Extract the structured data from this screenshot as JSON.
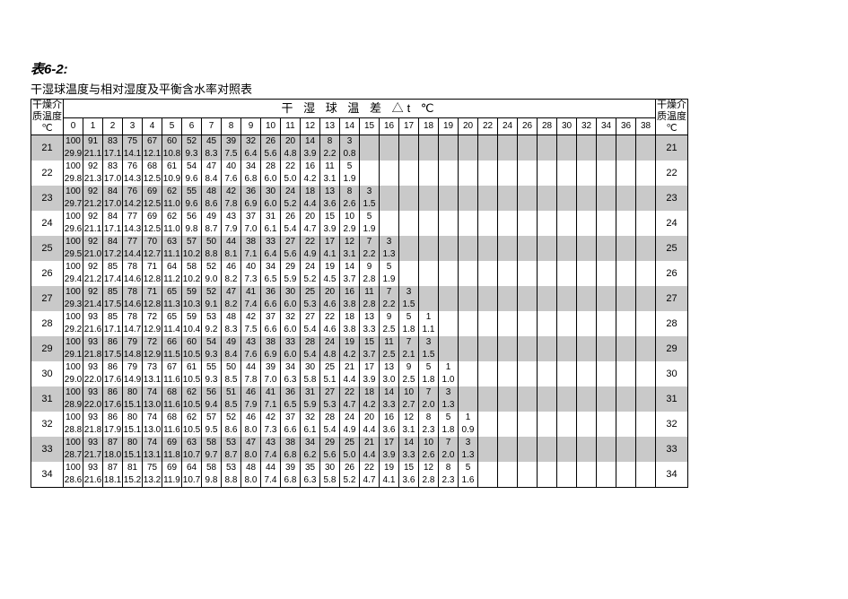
{
  "title": "表6-2:",
  "subtitle": "干湿球温度与相对湿度及平衡含水率对照表",
  "side_header": "干燥介质温度℃",
  "top_header_text": "干 湿 球 温 差   △t   ℃",
  "delta_t_cols": [
    "0",
    "1",
    "2",
    "3",
    "4",
    "5",
    "6",
    "7",
    "8",
    "9",
    "10",
    "11",
    "12",
    "13",
    "14",
    "15",
    "16",
    "17",
    "18",
    "19",
    "20",
    "22",
    "24",
    "26",
    "28",
    "30",
    "32",
    "34",
    "36",
    "38"
  ],
  "rows": [
    {
      "t": "21",
      "a": [
        "100",
        "91",
        "83",
        "75",
        "67",
        "60",
        "52",
        "45",
        "39",
        "32",
        "26",
        "20",
        "14",
        "8",
        "3"
      ],
      "b": [
        "29.9",
        "21.1",
        "17.1",
        "14.1",
        "12.1",
        "10.8",
        "9.3",
        "8.3",
        "7.5",
        "6.4",
        "5.6",
        "4.8",
        "3.9",
        "2.2",
        "0.8"
      ]
    },
    {
      "t": "22",
      "a": [
        "100",
        "92",
        "83",
        "76",
        "68",
        "61",
        "54",
        "47",
        "40",
        "34",
        "28",
        "22",
        "16",
        "11",
        "5"
      ],
      "b": [
        "29.8",
        "21.3",
        "17.0",
        "14.3",
        "12.5",
        "10.9",
        "9.6",
        "8.4",
        "7.6",
        "6.8",
        "6.0",
        "5.0",
        "4.2",
        "3.1",
        "1.9"
      ]
    },
    {
      "t": "23",
      "a": [
        "100",
        "92",
        "84",
        "76",
        "69",
        "62",
        "55",
        "48",
        "42",
        "36",
        "30",
        "24",
        "18",
        "13",
        "8",
        "3"
      ],
      "b": [
        "29.7",
        "21.2",
        "17.0",
        "14.2",
        "12.5",
        "11.0",
        "9.6",
        "8.6",
        "7.8",
        "6.9",
        "6.0",
        "5.2",
        "4.4",
        "3.6",
        "2.6",
        "1.5"
      ]
    },
    {
      "t": "24",
      "a": [
        "100",
        "92",
        "84",
        "77",
        "69",
        "62",
        "56",
        "49",
        "43",
        "37",
        "31",
        "26",
        "20",
        "15",
        "10",
        "5"
      ],
      "b": [
        "29.6",
        "21.1",
        "17.1",
        "14.3",
        "12.5",
        "11.0",
        "9.8",
        "8.7",
        "7.9",
        "7.0",
        "6.1",
        "5.4",
        "4.7",
        "3.9",
        "2.9",
        "1.9"
      ]
    },
    {
      "t": "25",
      "a": [
        "100",
        "92",
        "84",
        "77",
        "70",
        "63",
        "57",
        "50",
        "44",
        "38",
        "33",
        "27",
        "22",
        "17",
        "12",
        "7",
        "3"
      ],
      "b": [
        "29.5",
        "21.0",
        "17.2",
        "14.4",
        "12.7",
        "11.1",
        "10.2",
        "8.8",
        "8.1",
        "7.1",
        "6.4",
        "5.6",
        "4.9",
        "4.1",
        "3.1",
        "2.2",
        "1.3"
      ]
    },
    {
      "t": "26",
      "a": [
        "100",
        "92",
        "85",
        "78",
        "71",
        "64",
        "58",
        "52",
        "46",
        "40",
        "34",
        "29",
        "24",
        "19",
        "14",
        "9",
        "5"
      ],
      "b": [
        "29.4",
        "21.2",
        "17.4",
        "14.6",
        "12.8",
        "11.2",
        "10.2",
        "9.0",
        "8.2",
        "7.3",
        "6.5",
        "5.9",
        "5.2",
        "4.5",
        "3.7",
        "2.8",
        "1.9"
      ]
    },
    {
      "t": "27",
      "a": [
        "100",
        "92",
        "85",
        "78",
        "71",
        "65",
        "59",
        "52",
        "47",
        "41",
        "36",
        "30",
        "25",
        "20",
        "16",
        "11",
        "7",
        "3"
      ],
      "b": [
        "29.3",
        "21.4",
        "17.5",
        "14.6",
        "12.8",
        "11.3",
        "10.3",
        "9.1",
        "8.2",
        "7.4",
        "6.6",
        "6.0",
        "5.3",
        "4.6",
        "3.8",
        "2.8",
        "2.2",
        "1.5"
      ]
    },
    {
      "t": "28",
      "a": [
        "100",
        "93",
        "85",
        "78",
        "72",
        "65",
        "59",
        "53",
        "48",
        "42",
        "37",
        "32",
        "27",
        "22",
        "18",
        "13",
        "9",
        "5",
        "1"
      ],
      "b": [
        "29.2",
        "21.6",
        "17.1",
        "14.7",
        "12.9",
        "11.4",
        "10.4",
        "9.2",
        "8.3",
        "7.5",
        "6.6",
        "6.0",
        "5.4",
        "4.6",
        "3.8",
        "3.3",
        "2.5",
        "1.8",
        "1.1"
      ]
    },
    {
      "t": "29",
      "a": [
        "100",
        "93",
        "86",
        "79",
        "72",
        "66",
        "60",
        "54",
        "49",
        "43",
        "38",
        "33",
        "28",
        "24",
        "19",
        "15",
        "11",
        "7",
        "3"
      ],
      "b": [
        "29.1",
        "21.8",
        "17.5",
        "14.8",
        "12.9",
        "11.5",
        "10.5",
        "9.3",
        "8.4",
        "7.6",
        "6.9",
        "6.0",
        "5.4",
        "4.8",
        "4.2",
        "3.7",
        "2.5",
        "2.1",
        "1.5"
      ]
    },
    {
      "t": "30",
      "a": [
        "100",
        "93",
        "86",
        "79",
        "73",
        "67",
        "61",
        "55",
        "50",
        "44",
        "39",
        "34",
        "30",
        "25",
        "21",
        "17",
        "13",
        "9",
        "5",
        "1"
      ],
      "b": [
        "29.0",
        "22.0",
        "17.6",
        "14.9",
        "13.1",
        "11.6",
        "10.5",
        "9.3",
        "8.5",
        "7.8",
        "7.0",
        "6.3",
        "5.8",
        "5.1",
        "4.4",
        "3.9",
        "3.0",
        "2.5",
        "1.8",
        "1.0"
      ]
    },
    {
      "t": "31",
      "a": [
        "100",
        "93",
        "86",
        "80",
        "74",
        "68",
        "62",
        "56",
        "51",
        "46",
        "41",
        "36",
        "31",
        "27",
        "22",
        "18",
        "14",
        "10",
        "7",
        "3"
      ],
      "b": [
        "28.9",
        "22.0",
        "17.6",
        "15.1",
        "13.0",
        "11.6",
        "10.5",
        "9.4",
        "8.5",
        "7.9",
        "7.1",
        "6.5",
        "5.9",
        "5.3",
        "4.7",
        "4.2",
        "3.3",
        "2.7",
        "2.0",
        "1.3"
      ]
    },
    {
      "t": "32",
      "a": [
        "100",
        "93",
        "86",
        "80",
        "74",
        "68",
        "62",
        "57",
        "52",
        "46",
        "42",
        "37",
        "32",
        "28",
        "24",
        "20",
        "16",
        "12",
        "8",
        "5",
        "1"
      ],
      "b": [
        "28.8",
        "21.8",
        "17.9",
        "15.1",
        "13.0",
        "11.6",
        "10.5",
        "9.5",
        "8.6",
        "8.0",
        "7.3",
        "6.6",
        "6.1",
        "5.4",
        "4.9",
        "4.4",
        "3.6",
        "3.1",
        "2.3",
        "1.8",
        "0.9"
      ]
    },
    {
      "t": "33",
      "a": [
        "100",
        "93",
        "87",
        "80",
        "74",
        "69",
        "63",
        "58",
        "53",
        "47",
        "43",
        "38",
        "34",
        "29",
        "25",
        "21",
        "17",
        "14",
        "10",
        "7",
        "3"
      ],
      "b": [
        "28.7",
        "21.7",
        "18.0",
        "15.1",
        "13.1",
        "11.8",
        "10.7",
        "9.7",
        "8.7",
        "8.0",
        "7.4",
        "6.8",
        "6.2",
        "5.6",
        "5.0",
        "4.4",
        "3.9",
        "3.3",
        "2.6",
        "2.0",
        "1.3"
      ]
    },
    {
      "t": "34",
      "a": [
        "100",
        "93",
        "87",
        "81",
        "75",
        "69",
        "64",
        "58",
        "53",
        "48",
        "44",
        "39",
        "35",
        "30",
        "26",
        "22",
        "19",
        "15",
        "12",
        "8",
        "5"
      ],
      "b": [
        "28.6",
        "21.6",
        "18.1",
        "15.2",
        "13.2",
        "11.9",
        "10.7",
        "9.8",
        "8.8",
        "8.0",
        "7.4",
        "6.8",
        "6.3",
        "5.8",
        "5.2",
        "4.7",
        "4.1",
        "3.6",
        "2.8",
        "2.3",
        "1.6"
      ]
    }
  ]
}
